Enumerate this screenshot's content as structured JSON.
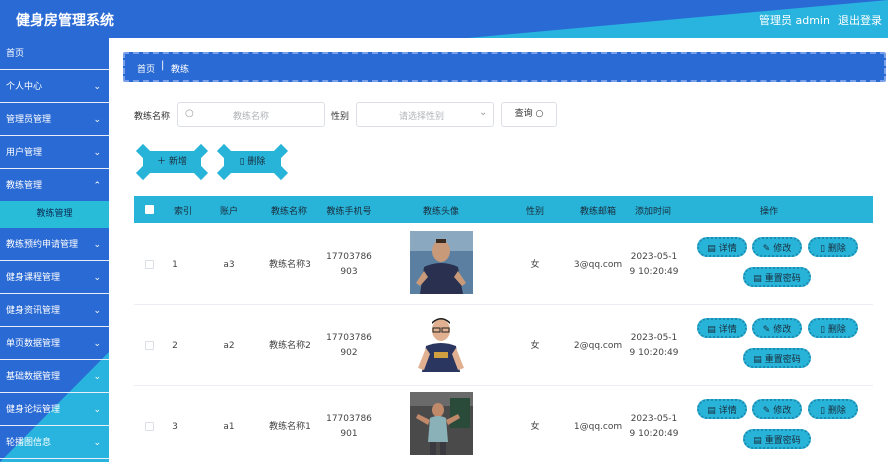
{
  "header": {
    "title": "健身房管理系统",
    "admin": "管理员 admin",
    "logout": "退出登录"
  },
  "sidebar": {
    "items": [
      {
        "label": "首页",
        "chevron": false
      },
      {
        "label": "个人中心",
        "chevron": true
      },
      {
        "label": "管理员管理",
        "chevron": true
      },
      {
        "label": "用户管理",
        "chevron": true
      },
      {
        "label": "教练管理",
        "chevron": true
      },
      {
        "label": "教练预约申请管理",
        "chevron": true
      },
      {
        "label": "健身课程管理",
        "chevron": true
      },
      {
        "label": "健身资讯管理",
        "chevron": true
      },
      {
        "label": "单页数据管理",
        "chevron": true
      },
      {
        "label": "基础数据管理",
        "chevron": true
      },
      {
        "label": "健身论坛管理",
        "chevron": true
      },
      {
        "label": "轮播图信息",
        "chevron": true
      }
    ],
    "active_sub": "教练管理"
  },
  "breadcrumb": {
    "home": "首页",
    "sep": "|",
    "current": "教练"
  },
  "search": {
    "name_label": "教练名称",
    "name_placeholder": "教练名称",
    "gender_label": "性别",
    "gender_placeholder": "请选择性别",
    "query_label": "查询"
  },
  "actions": {
    "add_label": "新增",
    "delete_label": "删除"
  },
  "table": {
    "headers": [
      "索引",
      "账户",
      "教练名称",
      "教练手机号",
      "教练头像",
      "性别",
      "教练邮箱",
      "添加时间",
      "操作"
    ],
    "rows": [
      {
        "index": "1",
        "account": "a3",
        "name": "教练名称3",
        "phone1": "17703786",
        "phone2": "903",
        "gender": "女",
        "email": "3@qq.com",
        "time1": "2023-05-1",
        "time2": "9 10:20:49"
      },
      {
        "index": "2",
        "account": "a2",
        "name": "教练名称2",
        "phone1": "17703786",
        "phone2": "902",
        "gender": "女",
        "email": "2@qq.com",
        "time1": "2023-05-1",
        "time2": "9 10:20:49"
      },
      {
        "index": "3",
        "account": "a1",
        "name": "教练名称1",
        "phone1": "17703786",
        "phone2": "901",
        "gender": "女",
        "email": "1@qq.com",
        "time1": "2023-05-1",
        "time2": "9 10:20:49"
      }
    ],
    "ops": {
      "detail": "详情",
      "edit": "修改",
      "delete": "删除",
      "reset": "重置密码"
    }
  }
}
